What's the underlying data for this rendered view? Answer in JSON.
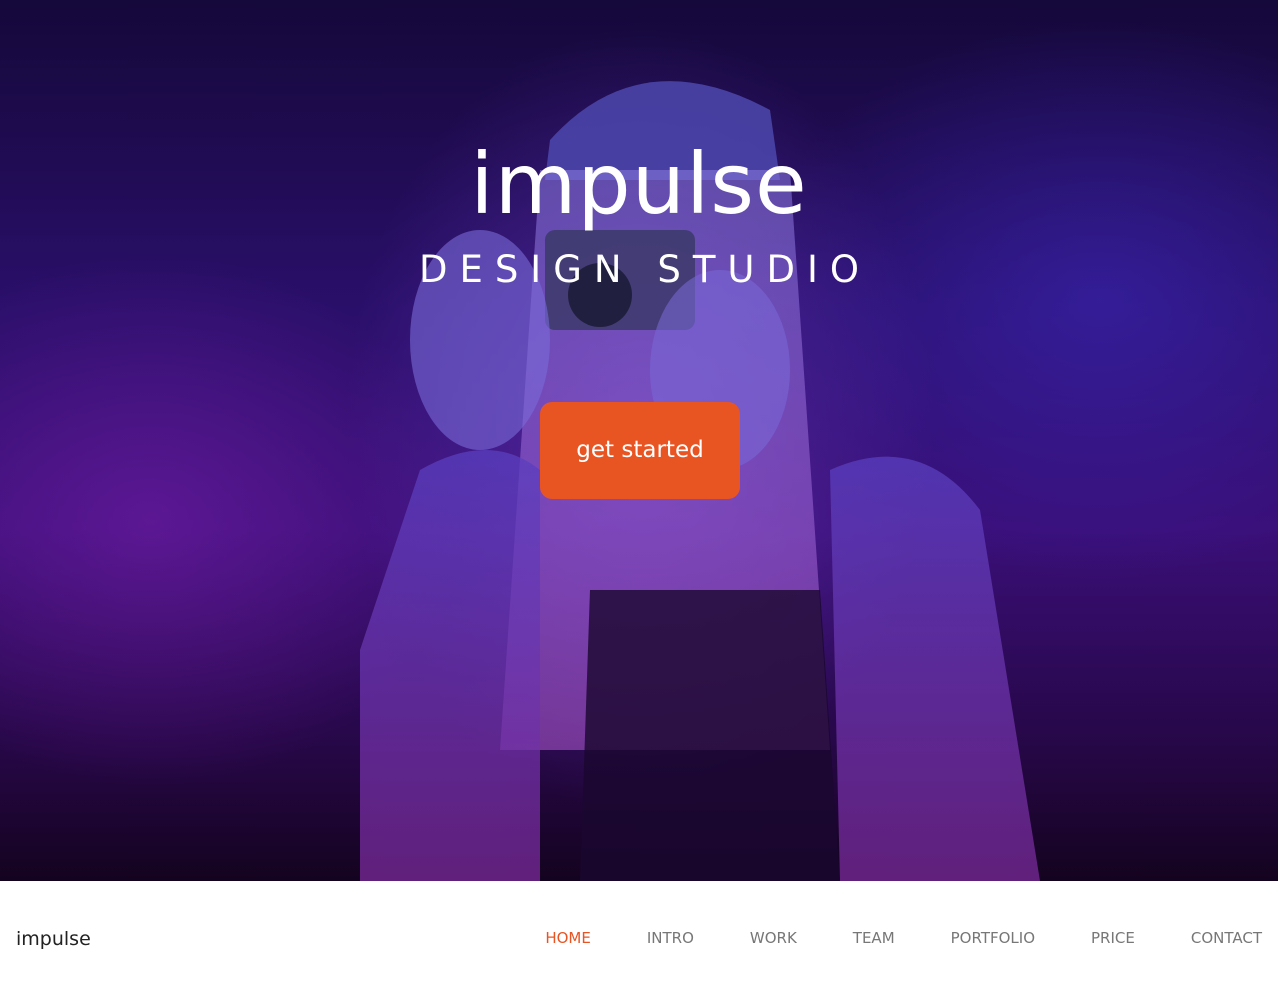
{
  "hero": {
    "title": "impulse",
    "subtitle": "DESIGN STUDIO",
    "cta_label": "get started"
  },
  "nav": {
    "brand": "impulse",
    "active_index": 0,
    "items": [
      {
        "label": "HOME"
      },
      {
        "label": "INTRO"
      },
      {
        "label": "WORK"
      },
      {
        "label": "TEAM"
      },
      {
        "label": "PORTFOLIO"
      },
      {
        "label": "PRICE"
      },
      {
        "label": "CONTACT"
      }
    ]
  },
  "colors": {
    "accent": "#e95423",
    "overlay_top": "#2a0f6a",
    "overlay_bottom": "#14031f",
    "nav_text": "#777777",
    "brand_text": "#222222"
  }
}
